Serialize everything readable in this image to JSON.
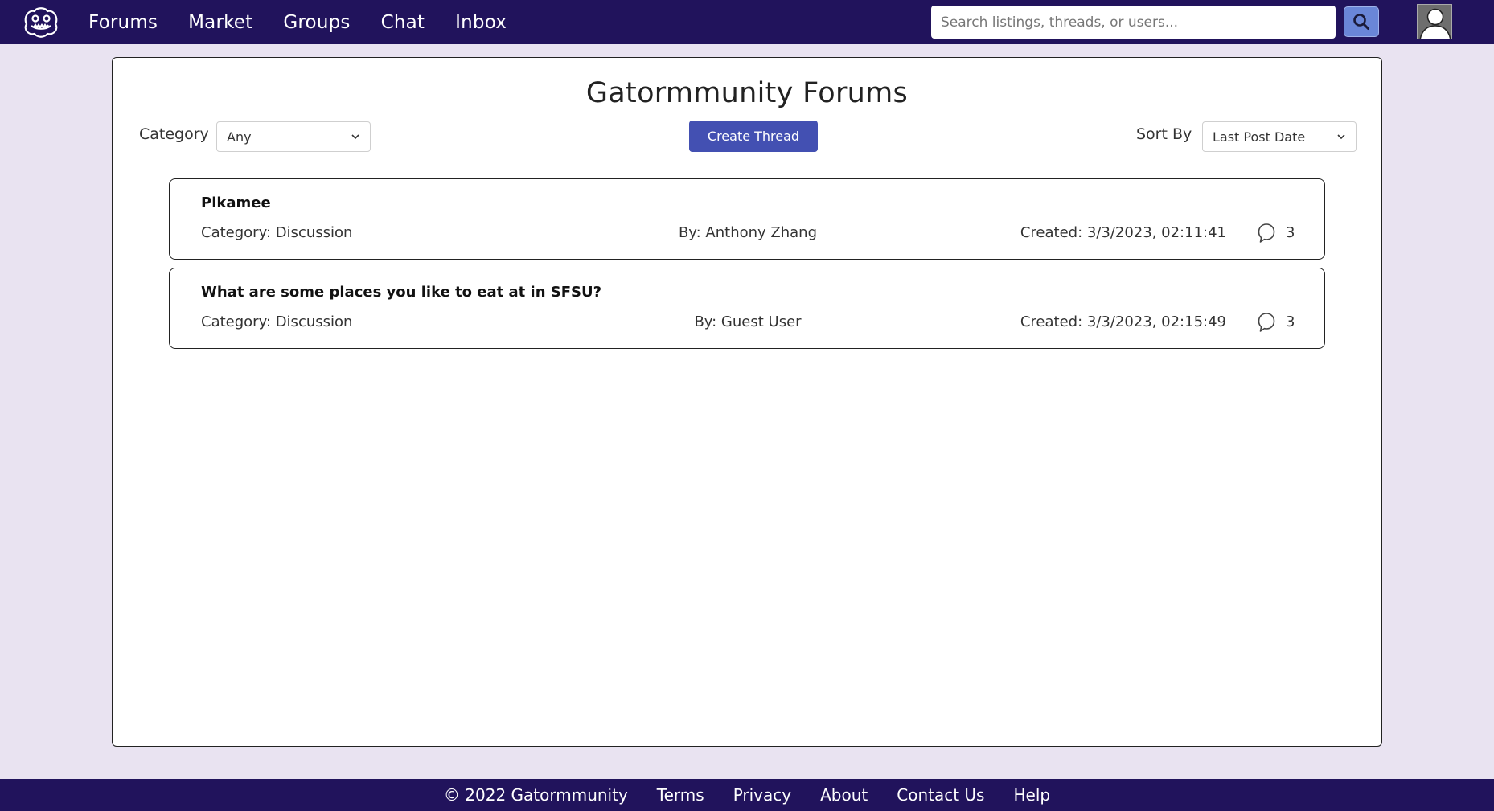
{
  "nav": {
    "logo_icon": "gator-logo-icon",
    "links": [
      "Forums",
      "Market",
      "Groups",
      "Chat",
      "Inbox"
    ],
    "search_placeholder": "Search listings, threads, or users...",
    "search_value": "",
    "search_icon": "search-icon",
    "avatar_icon": "user-avatar-icon"
  },
  "main": {
    "title": "Gatormmunity Forums",
    "category_label": "Category",
    "category_value": "Any",
    "create_button": "Create Thread",
    "sort_label": "Sort By",
    "sort_value": "Last Post Date"
  },
  "threads": [
    {
      "title": "Pikamee",
      "category": "Category: Discussion",
      "author": "By: Anthony Zhang",
      "created": "Created: 3/3/2023, 02:11:41",
      "comment_count": "3"
    },
    {
      "title": "What are some places you like to eat at in SFSU?",
      "category": "Category: Discussion",
      "author": "By: Guest User",
      "created": "Created: 3/3/2023, 02:15:49",
      "comment_count": "3"
    }
  ],
  "footer": {
    "copyright": "© 2022 Gatormmunity",
    "links": [
      "Terms",
      "Privacy",
      "About",
      "Contact Us",
      "Help"
    ]
  },
  "colors": {
    "nav_bg": "#21135c",
    "page_bg": "#e9e3f1",
    "primary_button": "#4350b2",
    "search_button": "#6a86d8"
  }
}
